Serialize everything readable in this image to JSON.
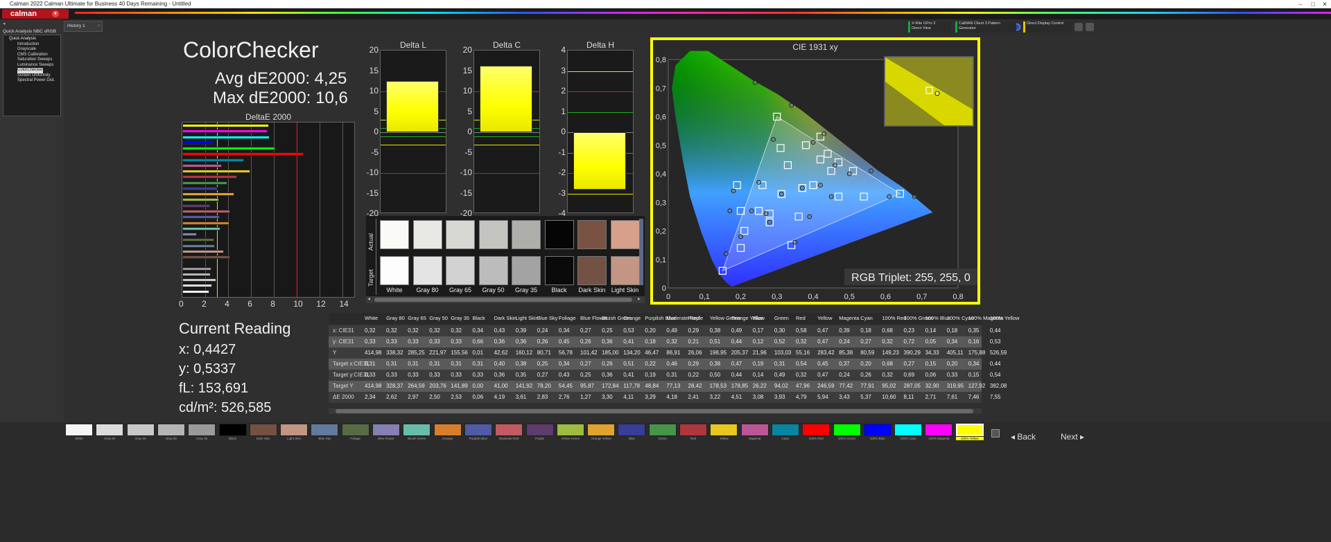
{
  "window": {
    "title": "Calman 2022 Calman Ultimate for Business 40 Days Remaining  - Untitled",
    "logo": "calman"
  },
  "sidebar": {
    "title": "Quick Analysis NBC sRGB",
    "group": "Quick Analysis",
    "items": [
      "Introduction",
      "Grayscale",
      "CMS Calibration",
      "Saturation Sweeps",
      "Luminance Sweeps",
      "ColorChecker",
      "Screen Uniformity",
      "Spectral Power Dist."
    ],
    "active_index": 5
  },
  "tabs": {
    "history": "History 1"
  },
  "devices": [
    {
      "label": "X-Rite i1Pro 3",
      "sub": "Direct View",
      "color": "#1aa83a"
    },
    {
      "label": "CalMAN Client 3 Pattern Generator",
      "sub": "",
      "color": "#1aa83a"
    },
    {
      "label": "Direct Display Control",
      "sub": "",
      "color": "#e8c800"
    }
  ],
  "header": {
    "title": "ColorChecker",
    "avg": "Avg dE2000: 4,25",
    "max": "Max dE2000: 10,6"
  },
  "de_chart": {
    "title": "DeltaE 2000",
    "xticks": [
      "0",
      "2",
      "4",
      "6",
      "8",
      "10",
      "12",
      "14"
    ],
    "xmax": 15,
    "threshold_yellow": 3,
    "threshold_red": 10
  },
  "delta_charts": [
    {
      "title": "Delta L",
      "ticks": [
        "20",
        "15",
        "10",
        "5",
        "0",
        "-5",
        "-10",
        "-15",
        "-20"
      ],
      "value": 12.5,
      "min": -20,
      "max": 20
    },
    {
      "title": "Delta C",
      "ticks": [
        "20",
        "15",
        "10",
        "5",
        "0",
        "-5",
        "-10",
        "-15",
        "-20"
      ],
      "value": 16.2,
      "min": -20,
      "max": 20
    },
    {
      "title": "Delta H",
      "ticks": [
        "4",
        "3",
        "2",
        "1",
        "0",
        "-1",
        "-2",
        "-3",
        "-4"
      ],
      "value": -2.8,
      "min": -4,
      "max": 4
    }
  ],
  "swatches": {
    "actual_label": "Actual",
    "target_label": "Target",
    "items": [
      {
        "name": "White",
        "actual": "#fafaf7",
        "target": "#fdfdfd"
      },
      {
        "name": "Gray 80",
        "actual": "#e8e8e4",
        "target": "#e4e4e4"
      },
      {
        "name": "Gray 65",
        "actual": "#d7d7d3",
        "target": "#d2d2d2"
      },
      {
        "name": "Gray 50",
        "actual": "#c4c4c0",
        "target": "#bcbcbc"
      },
      {
        "name": "Gray 35",
        "actual": "#aeaeaa",
        "target": "#a3a3a3"
      },
      {
        "name": "Black",
        "actual": "#050505",
        "target": "#0a0a0a"
      },
      {
        "name": "Dark Skin",
        "actual": "#7a5243",
        "target": "#735244"
      },
      {
        "name": "Light Skin",
        "actual": "#d6a08a",
        "target": "#c29682"
      }
    ]
  },
  "cie": {
    "title": "CIE 1931 xy",
    "xticks": [
      "0",
      "0,1",
      "0,2",
      "0,3",
      "0,4",
      "0,5",
      "0,6",
      "0,7",
      "0,8"
    ],
    "yticks": [
      "0,8",
      "0,7",
      "0,6",
      "0,5",
      "0,4",
      "0,3",
      "0,2",
      "0,1",
      "0"
    ],
    "rgb_triplet": "RGB Triplet: 255, 255, 0",
    "targets": [
      [
        0.64,
        0.33
      ],
      [
        0.3,
        0.6
      ],
      [
        0.15,
        0.06
      ],
      [
        0.3127,
        0.329
      ],
      [
        0.47,
        0.44
      ],
      [
        0.45,
        0.41
      ],
      [
        0.37,
        0.35
      ],
      [
        0.4,
        0.36
      ],
      [
        0.25,
        0.27
      ],
      [
        0.2,
        0.27
      ],
      [
        0.51,
        0.41
      ],
      [
        0.44,
        0.47
      ],
      [
        0.38,
        0.5
      ],
      [
        0.31,
        0.49
      ],
      [
        0.33,
        0.43
      ],
      [
        0.26,
        0.36
      ],
      [
        0.47,
        0.32
      ],
      [
        0.54,
        0.32
      ],
      [
        0.42,
        0.45
      ],
      [
        0.36,
        0.25
      ],
      [
        0.28,
        0.23
      ],
      [
        0.2,
        0.14
      ],
      [
        0.34,
        0.15
      ],
      [
        0.21,
        0.2
      ],
      [
        0.42,
        0.53
      ],
      [
        0.28,
        0.26
      ],
      [
        0.19,
        0.36
      ]
    ],
    "actuals": [
      [
        0.68,
        0.32
      ],
      [
        0.24,
        0.72
      ],
      [
        0.3127,
        0.329
      ],
      [
        0.46,
        0.43
      ],
      [
        0.5,
        0.4
      ],
      [
        0.42,
        0.36
      ],
      [
        0.37,
        0.35
      ],
      [
        0.29,
        0.52
      ],
      [
        0.43,
        0.54
      ],
      [
        0.34,
        0.64
      ],
      [
        0.56,
        0.41
      ],
      [
        0.4,
        0.51
      ],
      [
        0.25,
        0.37
      ],
      [
        0.18,
        0.34
      ],
      [
        0.61,
        0.32
      ],
      [
        0.28,
        0.23
      ],
      [
        0.39,
        0.25
      ],
      [
        0.17,
        0.27
      ],
      [
        0.23,
        0.27
      ],
      [
        0.27,
        0.26
      ],
      [
        0.16,
        0.12
      ],
      [
        0.2,
        0.18
      ],
      [
        0.35,
        0.16
      ],
      [
        0.45,
        0.32
      ]
    ]
  },
  "current": {
    "title": "Current Reading",
    "x": "x: 0,4427",
    "y": "y: 0,5337",
    "fl": "fL: 153,691",
    "cd": "cd/m²: 526,585"
  },
  "table": {
    "columns": [
      "White",
      "Gray 80",
      "Gray 65",
      "Gray 50",
      "Gray 35",
      "Black",
      "Dark Skin",
      "Light Skin",
      "Blue Sky",
      "Foliage",
      "Blue Flower",
      "Bluish Green",
      "Orange",
      "Purplish Blue",
      "Moderate Red",
      "Purple",
      "Yellow Green",
      "Orange Yellow",
      "Blue",
      "Green",
      "Red",
      "Yellow",
      "Magenta",
      "Cyan",
      "100% Red",
      "100% Green",
      "100% Blue",
      "100% Cyan",
      "100% Magenta",
      "100% Yellow"
    ],
    "rows": [
      {
        "label": "x: CIE31",
        "values": [
          "0,32",
          "0,32",
          "0,32",
          "0,32",
          "0,32",
          "0,34",
          "0,43",
          "0,39",
          "0,24",
          "0,34",
          "0,27",
          "0,25",
          "0,53",
          "0,20",
          "0,49",
          "0,29",
          "0,38",
          "0,49",
          "0,17",
          "0,30",
          "0,58",
          "0,47",
          "0,39",
          "0,18",
          "0,68",
          "0,23",
          "0,14",
          "0,18",
          "0,35",
          "0,44"
        ]
      },
      {
        "label": "y: CIE31",
        "values": [
          "0,33",
          "0,33",
          "0,33",
          "0,33",
          "0,33",
          "0,66",
          "0,36",
          "0,36",
          "0,26",
          "0,45",
          "0,26",
          "0,36",
          "0,41",
          "0,18",
          "0,32",
          "0,21",
          "0,51",
          "0,44",
          "0,12",
          "0,52",
          "0,32",
          "0,47",
          "0,24",
          "0,27",
          "0,32",
          "0,72",
          "0,05",
          "0,34",
          "0,16",
          "0,53"
        ]
      },
      {
        "label": "Y",
        "values": [
          "414,98",
          "338,32",
          "285,25",
          "221,97",
          "155,56",
          "0,01",
          "42,62",
          "160,12",
          "80,71",
          "56,78",
          "101,42",
          "185,00",
          "134,20",
          "46,47",
          "86,91",
          "26,06",
          "198,95",
          "205,37",
          "21,96",
          "103,03",
          "55,16",
          "283,42",
          "85,38",
          "80,59",
          "149,23",
          "390,29",
          "34,33",
          "405,11",
          "175,88",
          "526,59"
        ]
      },
      {
        "label": "Target x:CIE31",
        "values": [
          "0,31",
          "0,31",
          "0,31",
          "0,31",
          "0,31",
          "0,31",
          "0,40",
          "0,38",
          "0,25",
          "0,34",
          "0,27",
          "0,26",
          "0,51",
          "0,22",
          "0,46",
          "0,29",
          "0,38",
          "0,47",
          "0,19",
          "0,31",
          "0,54",
          "0,45",
          "0,37",
          "0,20",
          "0,68",
          "0,27",
          "0,15",
          "0,20",
          "0,34",
          "0,44"
        ]
      },
      {
        "label": "Target y:CIE31",
        "values": [
          "0,33",
          "0,33",
          "0,33",
          "0,33",
          "0,33",
          "0,33",
          "0,36",
          "0,35",
          "0,27",
          "0,43",
          "0,25",
          "0,36",
          "0,41",
          "0,19",
          "0,31",
          "0,22",
          "0,50",
          "0,44",
          "0,14",
          "0,49",
          "0,32",
          "0,47",
          "0,24",
          "0,26",
          "0,32",
          "0,69",
          "0,06",
          "0,33",
          "0,15",
          "0,54"
        ]
      },
      {
        "label": "Target Y",
        "values": [
          "414,98",
          "328,37",
          "264,59",
          "203,76",
          "141,89",
          "0,00",
          "41,00",
          "141,92",
          "78,20",
          "54,45",
          "95,87",
          "172,84",
          "117,78",
          "48,84",
          "77,13",
          "28,42",
          "178,53",
          "178,85",
          "26,22",
          "94,02",
          "47,96",
          "246,59",
          "77,42",
          "77,91",
          "95,02",
          "287,05",
          "32,90",
          "319,95",
          "127,92",
          "382,08"
        ]
      },
      {
        "label": "ΔE 2000",
        "values": [
          "2,34",
          "2,62",
          "2,97",
          "2,50",
          "2,53",
          "0,06",
          "4,19",
          "3,61",
          "2,83",
          "2,76",
          "1,27",
          "3,30",
          "4,11",
          "3,29",
          "4,18",
          "2,41",
          "3,22",
          "4,51",
          "3,08",
          "3,93",
          "4,79",
          "5,94",
          "3,43",
          "5,37",
          "10,60",
          "8,11",
          "2,71",
          "7,61",
          "7,46",
          "7,55"
        ]
      }
    ]
  },
  "patches": [
    {
      "name": "White",
      "color": "#f5f5f5"
    },
    {
      "name": "Gray 80",
      "color": "#dcdcdc"
    },
    {
      "name": "Gray 65",
      "color": "#c8c8c8"
    },
    {
      "name": "Gray 50",
      "color": "#b4b4b4"
    },
    {
      "name": "Gray 35",
      "color": "#9a9a9a"
    },
    {
      "name": "Black",
      "color": "#000000"
    },
    {
      "name": "Dark Skin",
      "color": "#735244"
    },
    {
      "name": "Light Skin",
      "color": "#c29682"
    },
    {
      "name": "Blue Sky",
      "color": "#627a9d"
    },
    {
      "name": "Foliage",
      "color": "#576c43"
    },
    {
      "name": "Blue Flower",
      "color": "#8580b1"
    },
    {
      "name": "Bluish Green",
      "color": "#67bdaa"
    },
    {
      "name": "Orange",
      "color": "#d67e2c"
    },
    {
      "name": "Purplish Blue",
      "color": "#505ba6"
    },
    {
      "name": "Moderate Red",
      "color": "#c15a63"
    },
    {
      "name": "Purple",
      "color": "#5e3c6c"
    },
    {
      "name": "Yellow Green",
      "color": "#9dbc40"
    },
    {
      "name": "Orange Yellow",
      "color": "#e0a32e"
    },
    {
      "name": "Blue",
      "color": "#383d96"
    },
    {
      "name": "Green",
      "color": "#469449"
    },
    {
      "name": "Red",
      "color": "#af363c"
    },
    {
      "name": "Yellow",
      "color": "#e7c71f"
    },
    {
      "name": "Magenta",
      "color": "#bb5695"
    },
    {
      "name": "Cyan",
      "color": "#0885a1"
    },
    {
      "name": "100% Red",
      "color": "#ff0000"
    },
    {
      "name": "100% Green",
      "color": "#00ff00"
    },
    {
      "name": "100% Blue",
      "color": "#0000ff"
    },
    {
      "name": "100% Cyan",
      "color": "#00ffff"
    },
    {
      "name": "100% Magenta",
      "color": "#ff00ff"
    },
    {
      "name": "100% Yellow",
      "color": "#ffff00"
    }
  ],
  "navigation": {
    "back": "Back",
    "next": "Next"
  },
  "de_values": [
    2.34,
    2.62,
    2.97,
    2.5,
    2.53,
    0.06,
    4.19,
    3.61,
    2.83,
    2.76,
    1.27,
    3.3,
    4.11,
    3.29,
    4.18,
    2.41,
    3.22,
    4.51,
    3.08,
    3.93,
    4.79,
    5.94,
    3.43,
    5.37,
    10.6,
    8.11,
    2.71,
    7.61,
    7.46,
    7.55
  ]
}
